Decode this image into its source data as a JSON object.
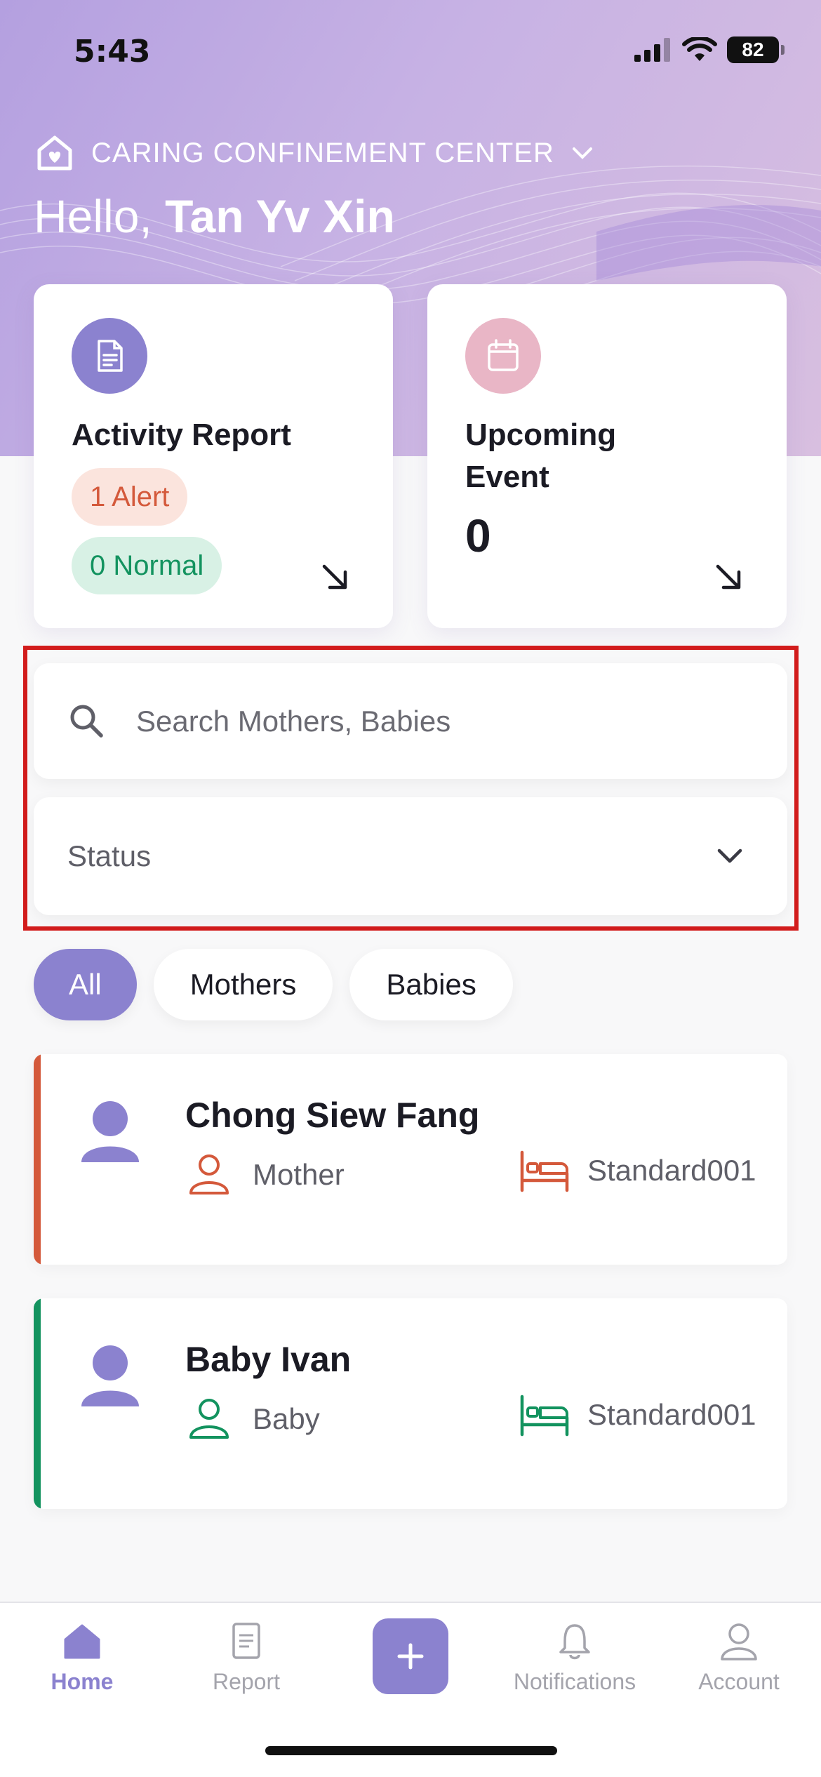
{
  "status_bar": {
    "time": "5:43",
    "battery": "82"
  },
  "header": {
    "center_name": "CARING CONFINEMENT CENTER",
    "greeting_prefix": "Hello,",
    "user_name": " Tan Yv Xin"
  },
  "cards": {
    "activity": {
      "title": "Activity Report",
      "alert": "1 Alert",
      "normal": "0 Normal"
    },
    "event": {
      "title": "Upcoming Event",
      "count": "0"
    }
  },
  "search": {
    "placeholder": "Search Mothers, Babies"
  },
  "status_select": {
    "label": "Status"
  },
  "filters": [
    "All",
    "Mothers",
    "Babies"
  ],
  "people": [
    {
      "name": "Chong Siew Fang",
      "role": "Mother",
      "room": "Standard001",
      "accent": "#d4593b"
    },
    {
      "name": "Baby Ivan",
      "role": "Baby",
      "room": "Standard001",
      "accent": "#13935f"
    }
  ],
  "tabs": [
    "Home",
    "Report",
    "Notifications",
    "Account"
  ],
  "colors": {
    "primary": "#8b82cf",
    "alert": "#d4593b",
    "normal": "#13935f"
  }
}
